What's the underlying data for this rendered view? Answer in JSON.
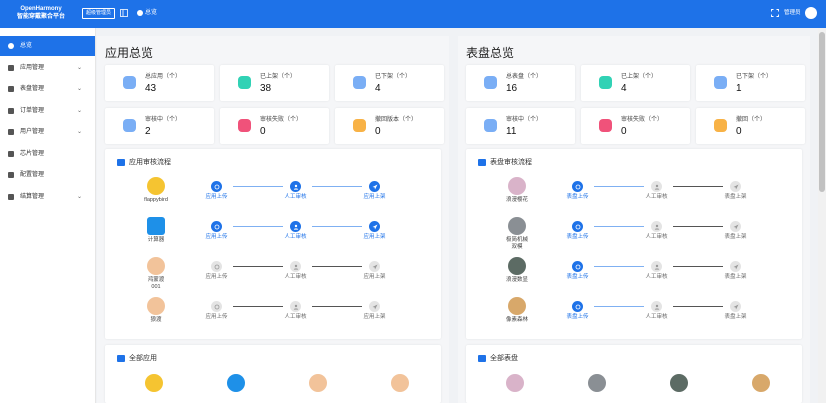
{
  "header": {
    "brand_line1": "OpenHarmony",
    "brand_line2": "智能穿戴聚合平台",
    "portal_button": "超级管理员",
    "breadcrumb": "总览",
    "user_name": "管理员"
  },
  "sidebar": {
    "items": [
      {
        "label": "总览",
        "icon": "dashboard-icon",
        "active": true,
        "expandable": false
      },
      {
        "label": "应用管理",
        "icon": "app-icon",
        "active": false,
        "expandable": true
      },
      {
        "label": "表盘管理",
        "icon": "dial-icon",
        "active": false,
        "expandable": true
      },
      {
        "label": "订单管理",
        "icon": "order-icon",
        "active": false,
        "expandable": true
      },
      {
        "label": "用户管理",
        "icon": "user-icon",
        "active": false,
        "expandable": true
      },
      {
        "label": "芯片管理",
        "icon": "chip-icon",
        "active": false,
        "expandable": false
      },
      {
        "label": "配置管理",
        "icon": "config-icon",
        "active": false,
        "expandable": false
      },
      {
        "label": "结算管理",
        "icon": "settlement-icon",
        "active": false,
        "expandable": true
      }
    ]
  },
  "apps": {
    "title": "应用总览",
    "stats": [
      {
        "label": "总应用（个）",
        "value": "43",
        "icon": "total-icon",
        "color": "#7aaef5"
      },
      {
        "label": "已上架（个）",
        "value": "38",
        "icon": "online-icon",
        "color": "#31d2b5"
      },
      {
        "label": "已下架（个）",
        "value": "4",
        "icon": "offline-icon",
        "color": "#7aaef5"
      },
      {
        "label": "审核中（个）",
        "value": "2",
        "icon": "review-icon",
        "color": "#7aaef5"
      },
      {
        "label": "审核失败（个）",
        "value": "0",
        "icon": "fail-icon",
        "color": "#f0527a"
      },
      {
        "label": "撤回版本（个）",
        "value": "0",
        "icon": "revoke-icon",
        "color": "#f8b246"
      }
    ],
    "flow_title": "应用审核流程",
    "steps": [
      "应用上传",
      "人工审核",
      "应用上架"
    ],
    "flow_rows": [
      {
        "name": "flappybird",
        "thumb": "#f5c431",
        "square": false,
        "progress": 3
      },
      {
        "name": "计算器",
        "thumb": "#1e90e8",
        "square": true,
        "progress": 3
      },
      {
        "name": "鸿蒙渡\n001",
        "thumb": "#f2c39a",
        "square": false,
        "progress": 0
      },
      {
        "name": "狼渡",
        "thumb": "#f2c39a",
        "square": false,
        "progress": 0
      }
    ],
    "all_title": "全部应用",
    "all_items": [
      {
        "thumb": "#f5c431"
      },
      {
        "thumb": "#1e90e8"
      },
      {
        "thumb": "#f2c39a"
      },
      {
        "thumb": "#f2c39a"
      }
    ]
  },
  "dials": {
    "title": "表盘总览",
    "stats": [
      {
        "label": "总表盘（个）",
        "value": "16",
        "icon": "total-icon",
        "color": "#7aaef5"
      },
      {
        "label": "已上架（个）",
        "value": "4",
        "icon": "online-icon",
        "color": "#31d2b5"
      },
      {
        "label": "已下架（个）",
        "value": "1",
        "icon": "offline-icon",
        "color": "#7aaef5"
      },
      {
        "label": "审核中（个）",
        "value": "11",
        "icon": "review-icon",
        "color": "#7aaef5"
      },
      {
        "label": "审核失败（个）",
        "value": "0",
        "icon": "fail-icon",
        "color": "#f0527a"
      },
      {
        "label": "撤回（个）",
        "value": "0",
        "icon": "revoke-icon",
        "color": "#f8b246"
      }
    ],
    "flow_title": "表盘审核流程",
    "steps": [
      "表盘上传",
      "人工审核",
      "表盘上架"
    ],
    "flow_rows": [
      {
        "name": "浪漫樱花",
        "thumb": "#d9b3c9",
        "progress": 1
      },
      {
        "name": "极简机械\n双模",
        "thumb": "#8a8f94",
        "progress": 1
      },
      {
        "name": "浪漫数显",
        "thumb": "#5c6b64",
        "progress": 1
      },
      {
        "name": "像素森林",
        "thumb": "#d8a86a",
        "progress": 1
      }
    ],
    "all_title": "全部表盘",
    "all_items": [
      {
        "thumb": "#d9b3c9"
      },
      {
        "thumb": "#8a8f94"
      },
      {
        "thumb": "#5c6b64"
      },
      {
        "thumb": "#d8a86a"
      }
    ]
  }
}
